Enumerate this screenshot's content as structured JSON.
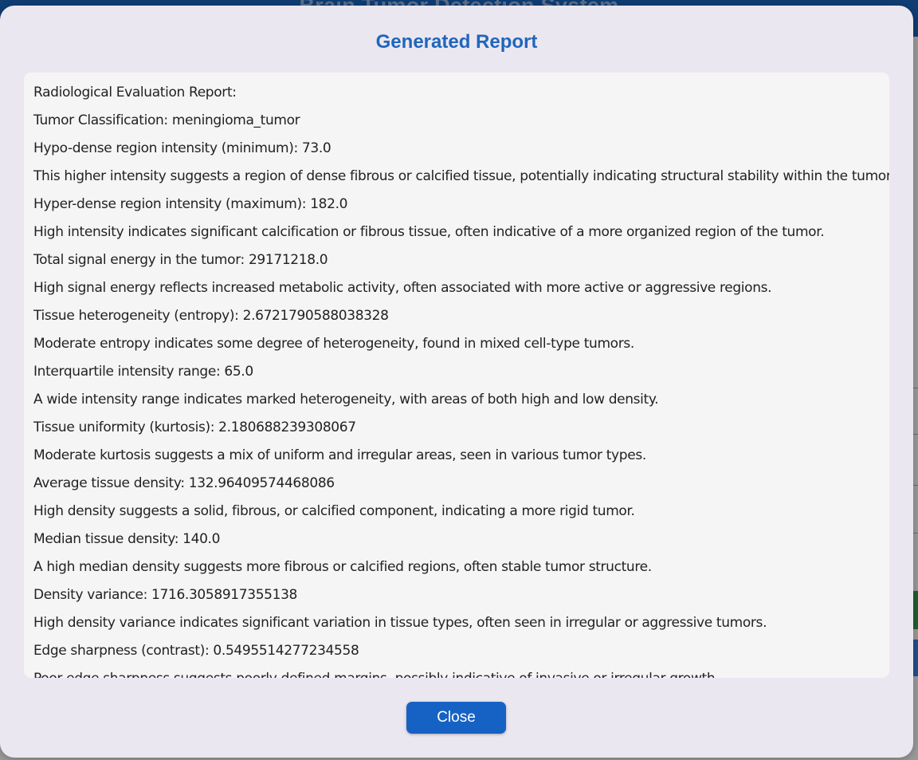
{
  "app": {
    "title": "Brain Tumor Detection System"
  },
  "dialog": {
    "title": "Generated Report",
    "close_label": "Close",
    "report_lines": [
      "Radiological Evaluation Report:",
      "Tumor Classification: meningioma_tumor",
      "Hypo-dense region intensity (minimum): 73.0",
      "This higher intensity suggests a region of dense fibrous or calcified tissue, potentially indicating structural stability within the tumor.",
      "Hyper-dense region intensity (maximum): 182.0",
      "High intensity indicates significant calcification or fibrous tissue, often indicative of a more organized region of the tumor.",
      "Total signal energy in the tumor: 29171218.0",
      "High signal energy reflects increased metabolic activity, often associated with more active or aggressive regions.",
      "Tissue heterogeneity (entropy): 2.6721790588038328",
      "Moderate entropy indicates some degree of heterogeneity, found in mixed cell-type tumors.",
      "Interquartile intensity range: 65.0",
      "A wide intensity range indicates marked heterogeneity, with areas of both high and low density.",
      "Tissue uniformity (kurtosis): 2.180688239308067",
      "Moderate kurtosis suggests a mix of uniform and irregular areas, seen in various tumor types.",
      "Average tissue density: 132.96409574468086",
      "High density suggests a solid, fibrous, or calcified component, indicating a more rigid tumor.",
      "Median tissue density: 140.0",
      "A high median density suggests more fibrous or calcified regions, often stable tumor structure.",
      "Density variance: 1716.3058917355138",
      "High density variance indicates significant variation in tissue types, often seen in irregular or aggressive tumors.",
      "Edge sharpness (contrast): 0.5495514277234558",
      "Poor edge sharpness suggests poorly defined margins, possibly indicative of invasive or irregular growth."
    ]
  },
  "colors": {
    "accent": "#1f66bd",
    "button": "#1662c4",
    "header": "#0f3d74"
  }
}
